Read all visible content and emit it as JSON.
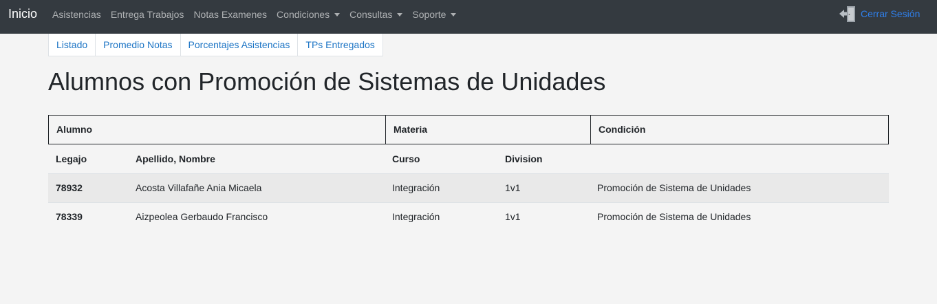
{
  "nav": {
    "brand": "Inicio",
    "links": [
      {
        "label": "Asistencias"
      },
      {
        "label": "Entrega Trabajos"
      },
      {
        "label": "Notas Examenes"
      },
      {
        "label": "Condiciones"
      },
      {
        "label": "Consultas"
      },
      {
        "label": "Soporte"
      }
    ],
    "logout_label": "Cerrar Sesión",
    "logout_icon": "door-exit-icon"
  },
  "tabs": [
    "Listado",
    "Promedio Notas",
    "Porcentajes Asistencias",
    "TPs Entregados"
  ],
  "page_title": "Alumnos con Promoción de Sistemas de Unidades",
  "table": {
    "group_headers": [
      "Alumno",
      "Materia",
      "Condición"
    ],
    "column_headers": [
      "Legajo",
      "Apellido, Nombre",
      "Curso",
      "Division"
    ],
    "rows": [
      {
        "legajo": "78932",
        "nombre": "Acosta Villafañe Ania Micaela",
        "curso": "Integración",
        "division": "1v1",
        "condicion": "Promoción de Sistema de Unidades"
      },
      {
        "legajo": "78339",
        "nombre": "Aizpeolea Gerbaudo Francisco",
        "curso": "Integración",
        "division": "1v1",
        "condicion": "Promoción de Sistema de Unidades"
      }
    ]
  },
  "colors": {
    "navbar_bg": "#343a40",
    "link_blue": "#1a73c4",
    "page_bg": "#f4f4f4"
  }
}
